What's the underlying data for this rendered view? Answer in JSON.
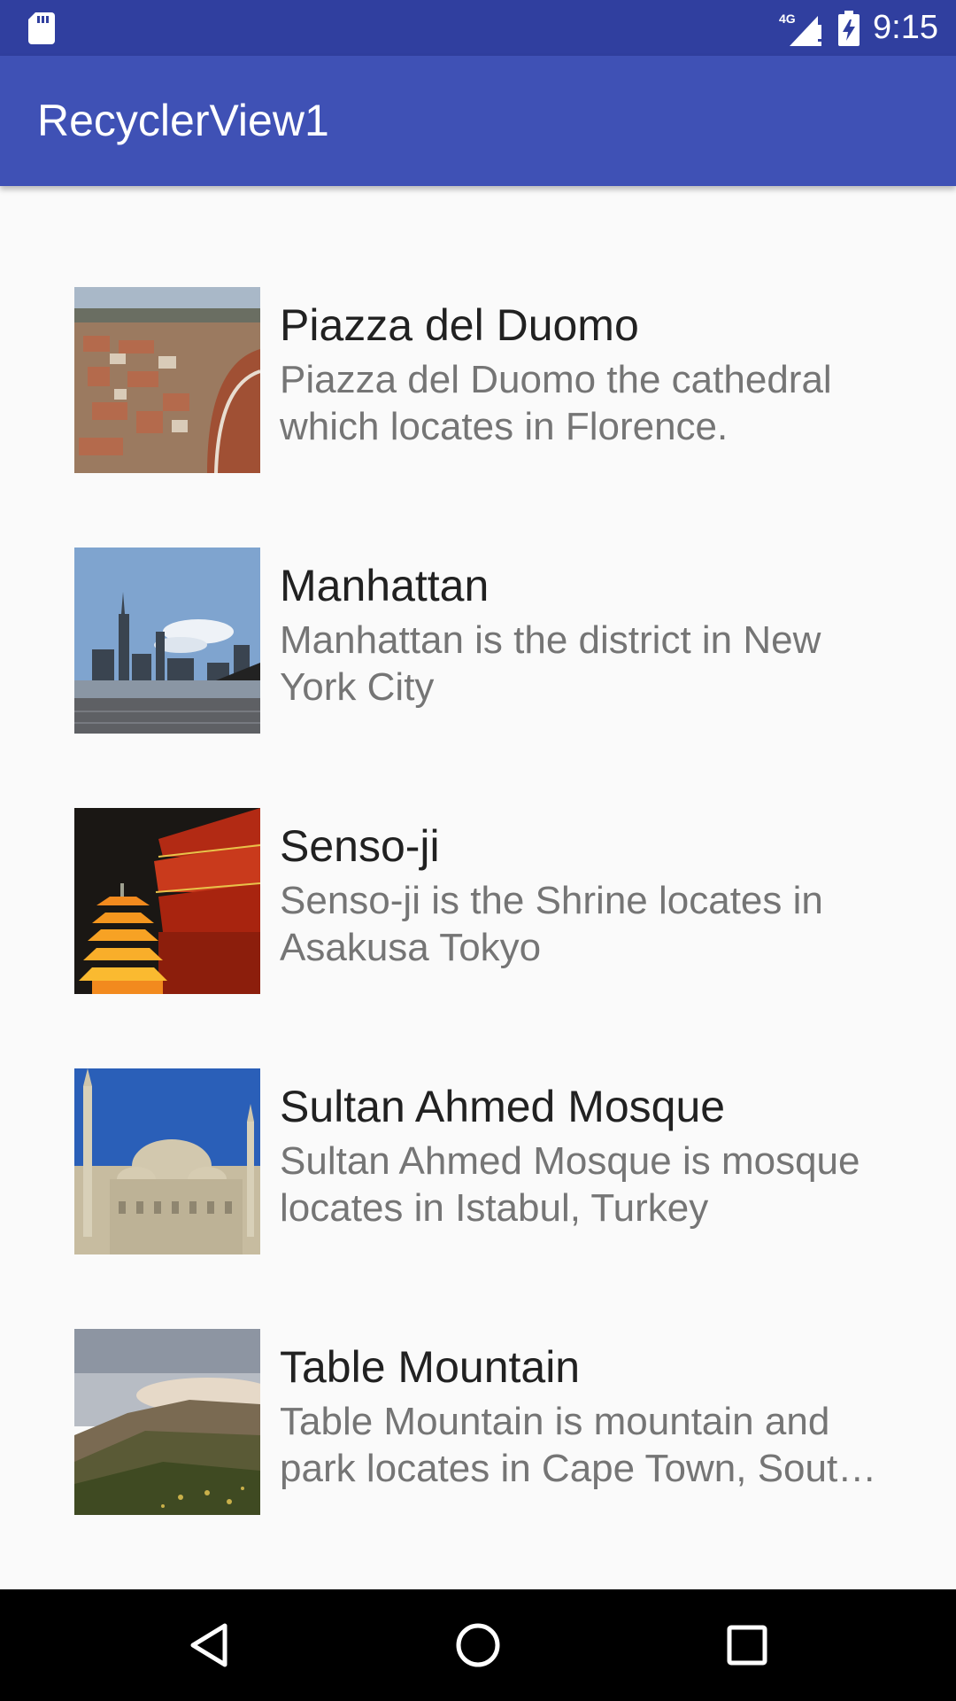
{
  "status_bar": {
    "time": "9:15",
    "network": "4G",
    "icons": [
      "sd-card-icon",
      "signal-icon",
      "battery-icon"
    ]
  },
  "app_bar": {
    "title": "RecyclerView1"
  },
  "items": [
    {
      "title": "Piazza del Duomo",
      "description": "Piazza del Duomo the cathedral which locates in Florence.",
      "image": "florence-cathedral-photo"
    },
    {
      "title": "Manhattan",
      "description": "Manhattan is the district in New York City",
      "image": "manhattan-skyline-photo"
    },
    {
      "title": "Senso-ji",
      "description": "Senso-ji is the Shrine locates in Asakusa Tokyo",
      "image": "senso-ji-pagoda-photo"
    },
    {
      "title": "Sultan Ahmed Mosque",
      "description": "Sultan Ahmed Mosque is mosque locates in Istabul, Turkey",
      "image": "blue-mosque-photo"
    },
    {
      "title": "Table Mountain",
      "description": "Table Mountain is mountain and park locates in Cape Town, South Africa",
      "image": "table-mountain-photo"
    }
  ],
  "nav_bar": {
    "buttons": [
      "back-icon",
      "home-icon",
      "recents-icon"
    ]
  },
  "colors": {
    "status_bar": "#303f9f",
    "app_bar": "#3f51b5",
    "background": "#fafafa",
    "title_text": "#212121",
    "desc_text": "#757575"
  }
}
